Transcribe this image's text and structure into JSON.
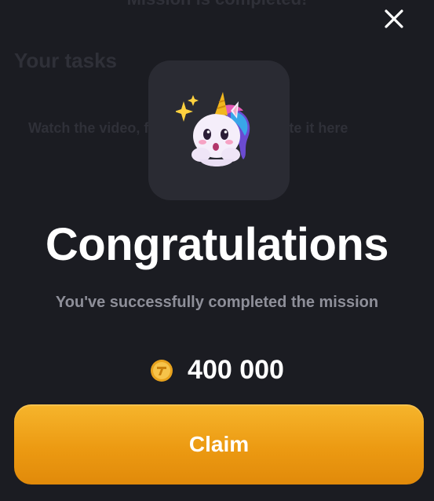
{
  "background": {
    "title": "Mission is completed!",
    "section_heading": "Your tasks",
    "task_text": "Watch the video, find the code and paste it here"
  },
  "modal": {
    "icon": "unicorn-emoji-icon",
    "headline": "Congratulations",
    "subtitle": "You've successfully completed the mission",
    "reward": {
      "icon": "gold-coin-icon",
      "amount": "400 000"
    },
    "claim_label": "Claim",
    "close_icon": "close-icon"
  },
  "colors": {
    "background": "#1b1c22",
    "tile": "#2a2b33",
    "subtitle": "#8e8f99",
    "accent": "#ef9e16"
  }
}
